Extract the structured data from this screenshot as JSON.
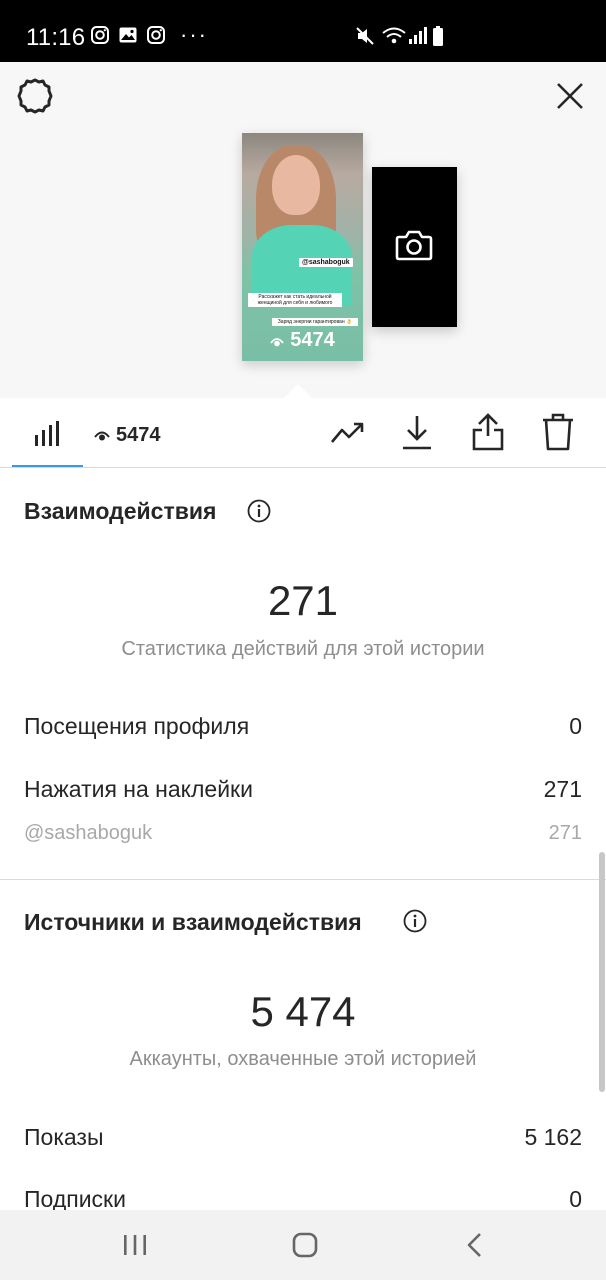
{
  "status_bar": {
    "time": "11:16",
    "dots": "···",
    "icons": [
      "instagram-icon",
      "gallery-icon",
      "instagram-icon",
      "mute-icon",
      "wifi-icon",
      "signal-icon",
      "battery-icon"
    ]
  },
  "preview": {
    "story_tag": "@sashaboguk",
    "story_caption": "Расскажет как стать идеальной женщиной для себя и любимого",
    "story_caption_2": "Заряд энергии гарантирован 👌",
    "story_views": "5474",
    "second_story_icon": "camera-icon"
  },
  "toolbar": {
    "views": "5474",
    "icons": [
      "bar-chart-icon",
      "eye-icon",
      "trend-icon",
      "download-icon",
      "share-icon",
      "trash-icon"
    ]
  },
  "interactions": {
    "title": "Взаимодействия",
    "total": "271",
    "subtitle": "Статистика действий для этой истории",
    "rows": [
      {
        "label": "Посещения профиля",
        "value": "0"
      },
      {
        "label": "Нажатия на наклейки",
        "value": "271"
      },
      {
        "label": "@sashaboguk",
        "value": "271"
      }
    ]
  },
  "discovery": {
    "title": "Источники и взаимодействия",
    "total": "5 474",
    "subtitle": "Аккаунты, охваченные этой историей",
    "rows": [
      {
        "label": "Показы",
        "value": "5 162"
      },
      {
        "label": "Подписки",
        "value": "0"
      }
    ]
  },
  "colors": {
    "accent": "#3897f0",
    "story_bg": "#7ec3a8",
    "text": "#262626",
    "muted": "#8e8e8e"
  }
}
